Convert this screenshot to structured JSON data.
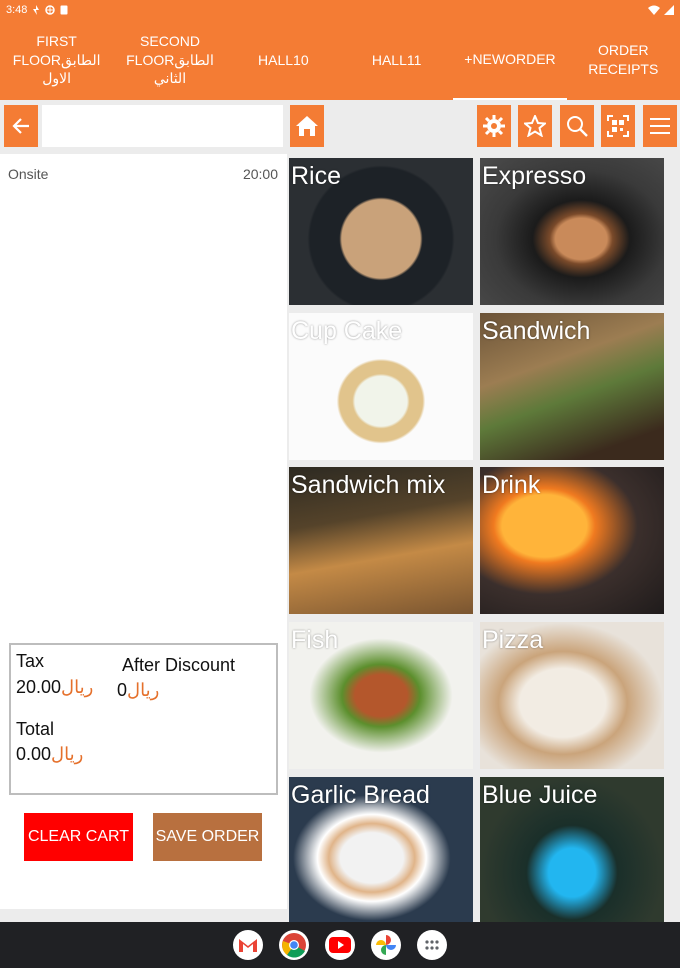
{
  "status": {
    "time": "3:48"
  },
  "tabs": [
    {
      "line1": "FIRST",
      "line2": "FLOORالطابق",
      "line3": "الاول"
    },
    {
      "line1": "SECOND",
      "line2": "FLOORالطابق",
      "line3": "الثاني"
    },
    {
      "line1": "HALL10",
      "line2": "",
      "line3": ""
    },
    {
      "line1": "HALL11",
      "line2": "",
      "line3": ""
    },
    {
      "line1": "+NEWORDER",
      "line2": "",
      "line3": ""
    },
    {
      "line1": "ORDER",
      "line2": "RECEIPTS",
      "line3": ""
    }
  ],
  "order": {
    "type": "Onsite",
    "time": "20:00"
  },
  "summary": {
    "tax_label": "Tax",
    "tax_value": "20.00",
    "after_discount_label": "After Discount",
    "after_discount_value": "0",
    "total_label": "Total",
    "total_value": "0.00",
    "currency": "ريال"
  },
  "actions": {
    "clear_cart": "CLEAR CART",
    "save_order": "SAVE ORDER"
  },
  "menu": [
    {
      "name": "Rice"
    },
    {
      "name": "Expresso"
    },
    {
      "name": "Cup Cake"
    },
    {
      "name": "Sandwich"
    },
    {
      "name": "Sandwich mix"
    },
    {
      "name": "Drink"
    },
    {
      "name": "Fish"
    },
    {
      "name": "Pizza"
    },
    {
      "name": "Garlic Bread"
    },
    {
      "name": "Blue Juice"
    }
  ],
  "colors": {
    "accent": "#f47c34",
    "clear": "#ff0000",
    "save": "#b8703f"
  }
}
